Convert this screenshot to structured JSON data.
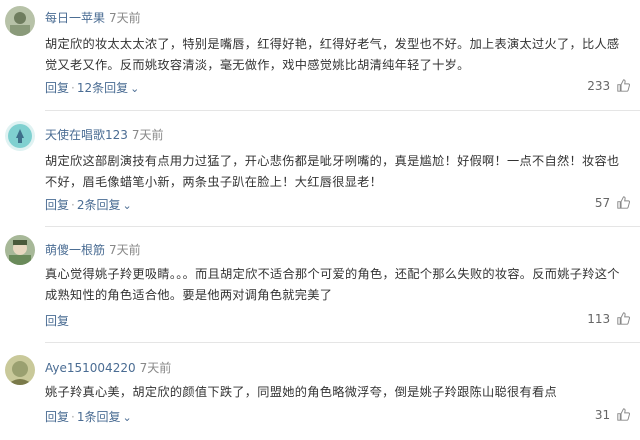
{
  "comments": [
    {
      "user": "每日一苹果",
      "time": "7天前",
      "text": "胡定欣的妆太太太浓了，特别是嘴唇，红得好艳，红得好老气，发型也不好。加上表演太过火了，比人感觉又老又作。反而姚玫容清淡，毫无做作，戏中感觉姚比胡清纯年轻了十岁。",
      "reply_label": "回复",
      "sub_replies": "12条回复",
      "likes": "233",
      "avatar_color": "#8a9a7a"
    },
    {
      "user": "天使在唱歌123",
      "time": "7天前",
      "text": "胡定欣这部剧演技有点用力过猛了，开心悲伤都是呲牙咧嘴的，真是尴尬！好假啊！一点不自然！妆容也不好，眉毛像蜡笔小新，两条虫子趴在脸上！大红唇很显老！",
      "reply_label": "回复",
      "sub_replies": "2条回复",
      "likes": "57",
      "avatar_color": "#7fd0d0"
    },
    {
      "user": "萌傻一根筋",
      "time": "7天前",
      "text": "真心觉得姚子羚更吸睛。。。而且胡定欣不适合那个可爱的角色，还配个那么失败的妆容。反而姚子羚这个成熟知性的角色适合他。要是他两对调角色就完美了",
      "reply_label": "回复",
      "sub_replies": "",
      "likes": "113",
      "avatar_color": "#6a8a5a"
    },
    {
      "user": "Aye151004220",
      "time": "7天前",
      "text": "姚子羚真心美，胡定欣的颜值下跌了，同盟她的角色略微浮夸，倒是姚子羚跟陈山聪很有看点",
      "reply_label": "回复",
      "sub_replies": "1条回复",
      "likes": "31",
      "avatar_color": "#9aa070"
    }
  ]
}
